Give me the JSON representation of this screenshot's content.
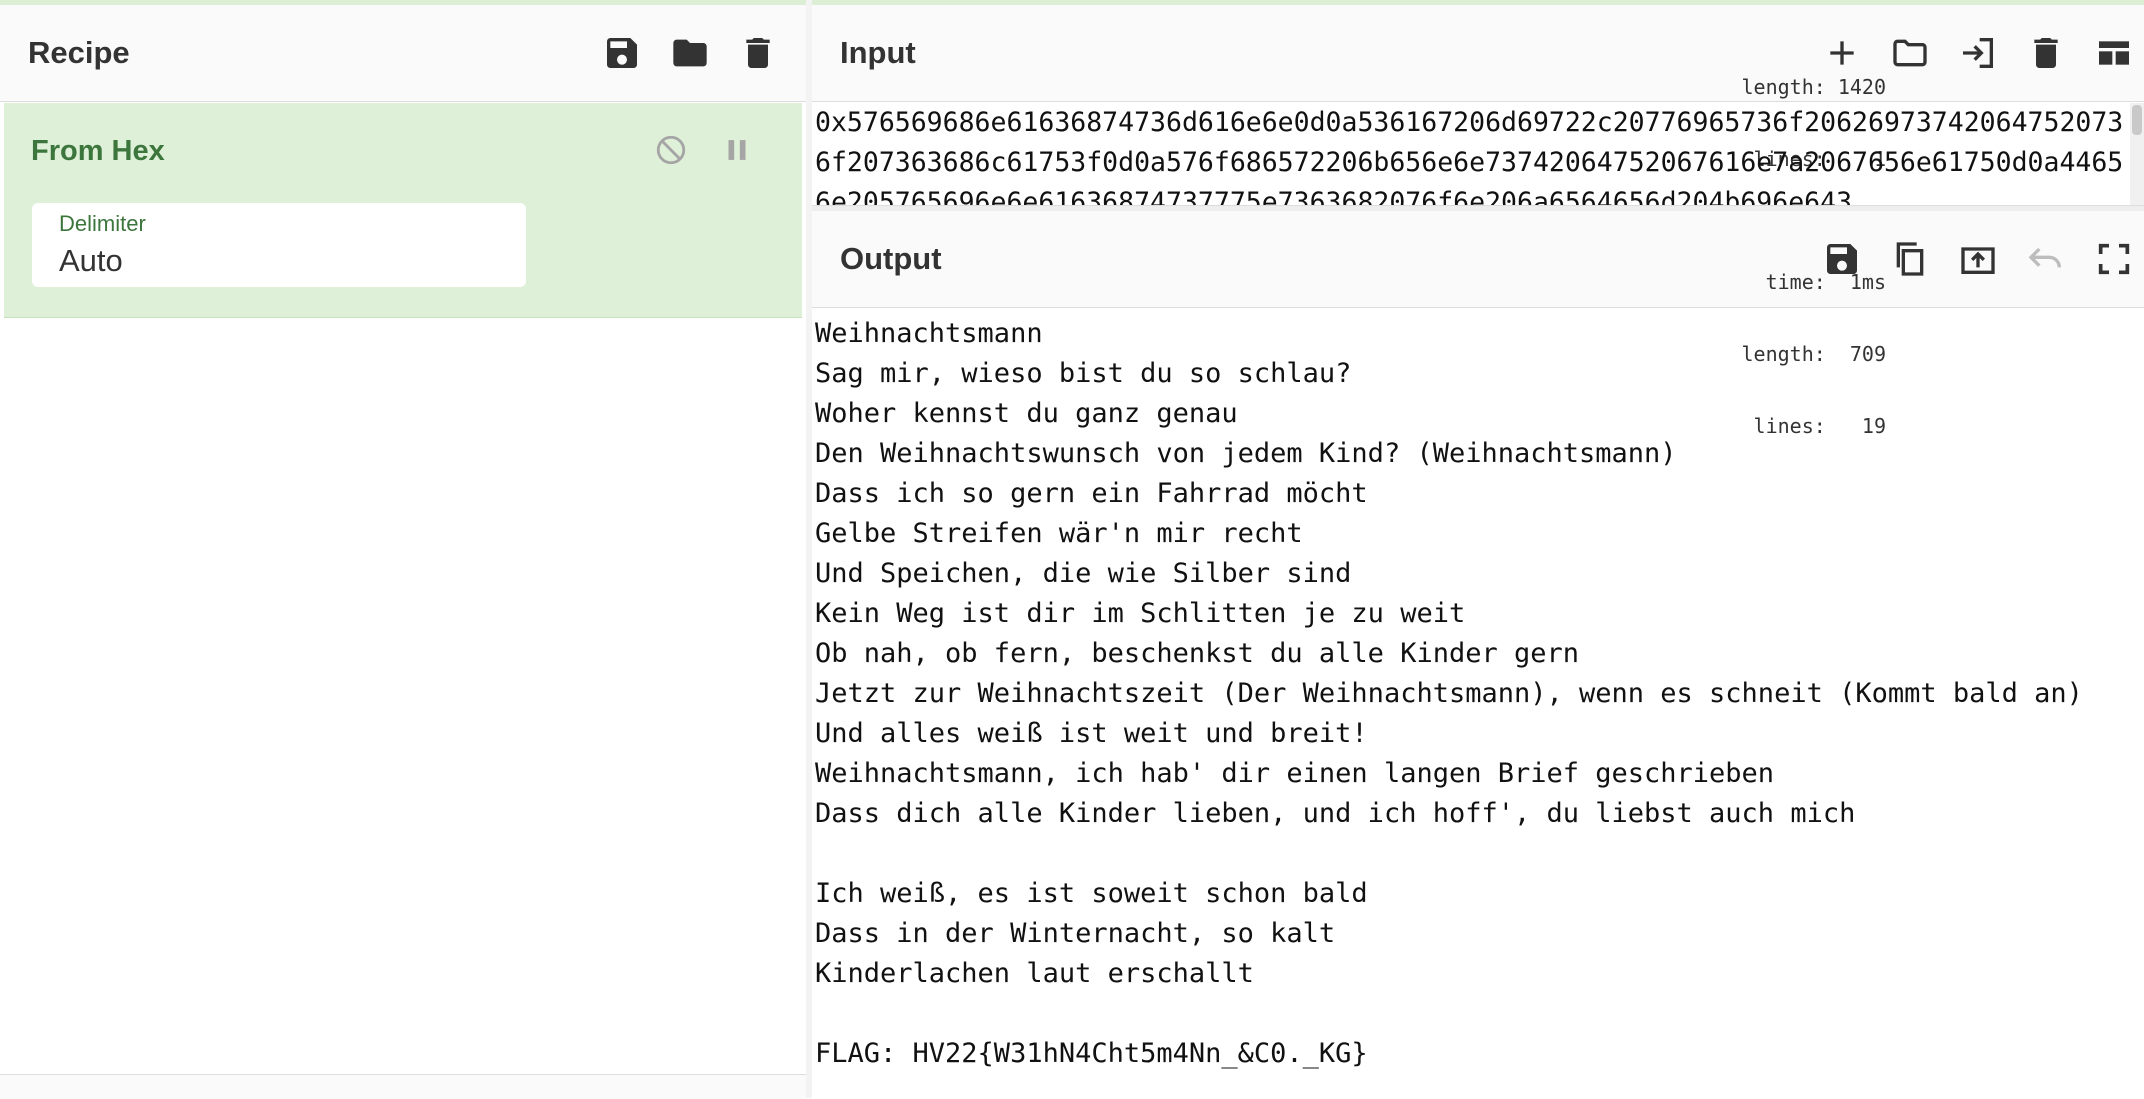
{
  "recipe": {
    "title": "Recipe",
    "icons": [
      "save-icon",
      "folder-icon",
      "trash-icon"
    ],
    "operation": {
      "name": "From Hex",
      "icons": [
        "disable-icon",
        "pause-icon"
      ],
      "arg_label": "Delimiter",
      "arg_value": "Auto"
    }
  },
  "input": {
    "title": "Input",
    "stats": {
      "length": "length: 1420",
      "lines": "lines:    1"
    },
    "icons": [
      "add-icon",
      "open-folder-icon",
      "load-icon",
      "trash-icon",
      "layout-icon"
    ],
    "text": "0x576569686e61636874736d616e6e0d0a536167206d69722c20776965736f206269737420647520736f207363686c61753f0d0a576f686572206b656e6e73742064752067616e7a2067656e61750d0a44656e205765696e6e61636874737775e7363682076f6e206a6564656d204b696e643"
  },
  "output": {
    "title": "Output",
    "stats": {
      "time": "time:  1ms",
      "length": "length:  709",
      "lines": "lines:   19"
    },
    "icons": [
      "save-icon",
      "copy-icon",
      "replace-input-icon",
      "undo-icon",
      "fullscreen-icon"
    ],
    "text": "Weihnachtsmann\nSag mir, wieso bist du so schlau?\nWoher kennst du ganz genau\nDen Weihnachtswunsch von jedem Kind? (Weihnachtsmann)\nDass ich so gern ein Fahrrad möcht\nGelbe Streifen wär'n mir recht\nUnd Speichen, die wie Silber sind\nKein Weg ist dir im Schlitten je zu weit\nOb nah, ob fern, beschenkst du alle Kinder gern\nJetzt zur Weihnachtszeit (Der Weihnachtsmann), wenn es schneit (Kommt bald an)\nUnd alles weiß ist weit und breit!\nWeihnachtsmann, ich hab' dir einen langen Brief geschrieben\nDass dich alle Kinder lieben, und ich hoff', du liebst auch mich\n\nIch weiß, es ist soweit schon bald\nDass in der Winternacht, so kalt\nKinderlachen laut erschallt\n\nFLAG: HV22{W31hN4Cht5m4Nn_&C0._KG}"
  },
  "colors": {
    "operation_bg": "#dff0d8",
    "operation_text": "#3c763d",
    "header_bg": "#fafafa"
  }
}
